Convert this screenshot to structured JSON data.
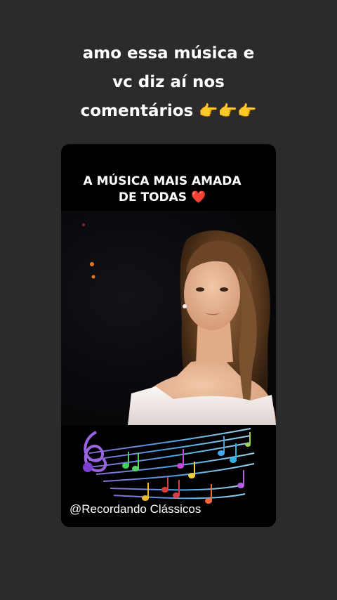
{
  "caption": {
    "line1": "amo essa música e",
    "line2": "vc diz aí nos",
    "line3": "comentários",
    "emoji": "👉👉👉"
  },
  "card": {
    "title_line1": "A MÚSICA MAIS AMADA",
    "title_line2": "DE TODAS",
    "title_emoji": "❤️",
    "handle": "@Recordando Clássicos"
  },
  "icons": {
    "pointing": "hand-pointing-right-icon",
    "heart": "red-heart-icon",
    "music": "music-notes-staff-icon"
  },
  "colors": {
    "background": "#2b2b2b",
    "card": "#000000",
    "text": "#ffffff",
    "heart": "#e53935"
  }
}
